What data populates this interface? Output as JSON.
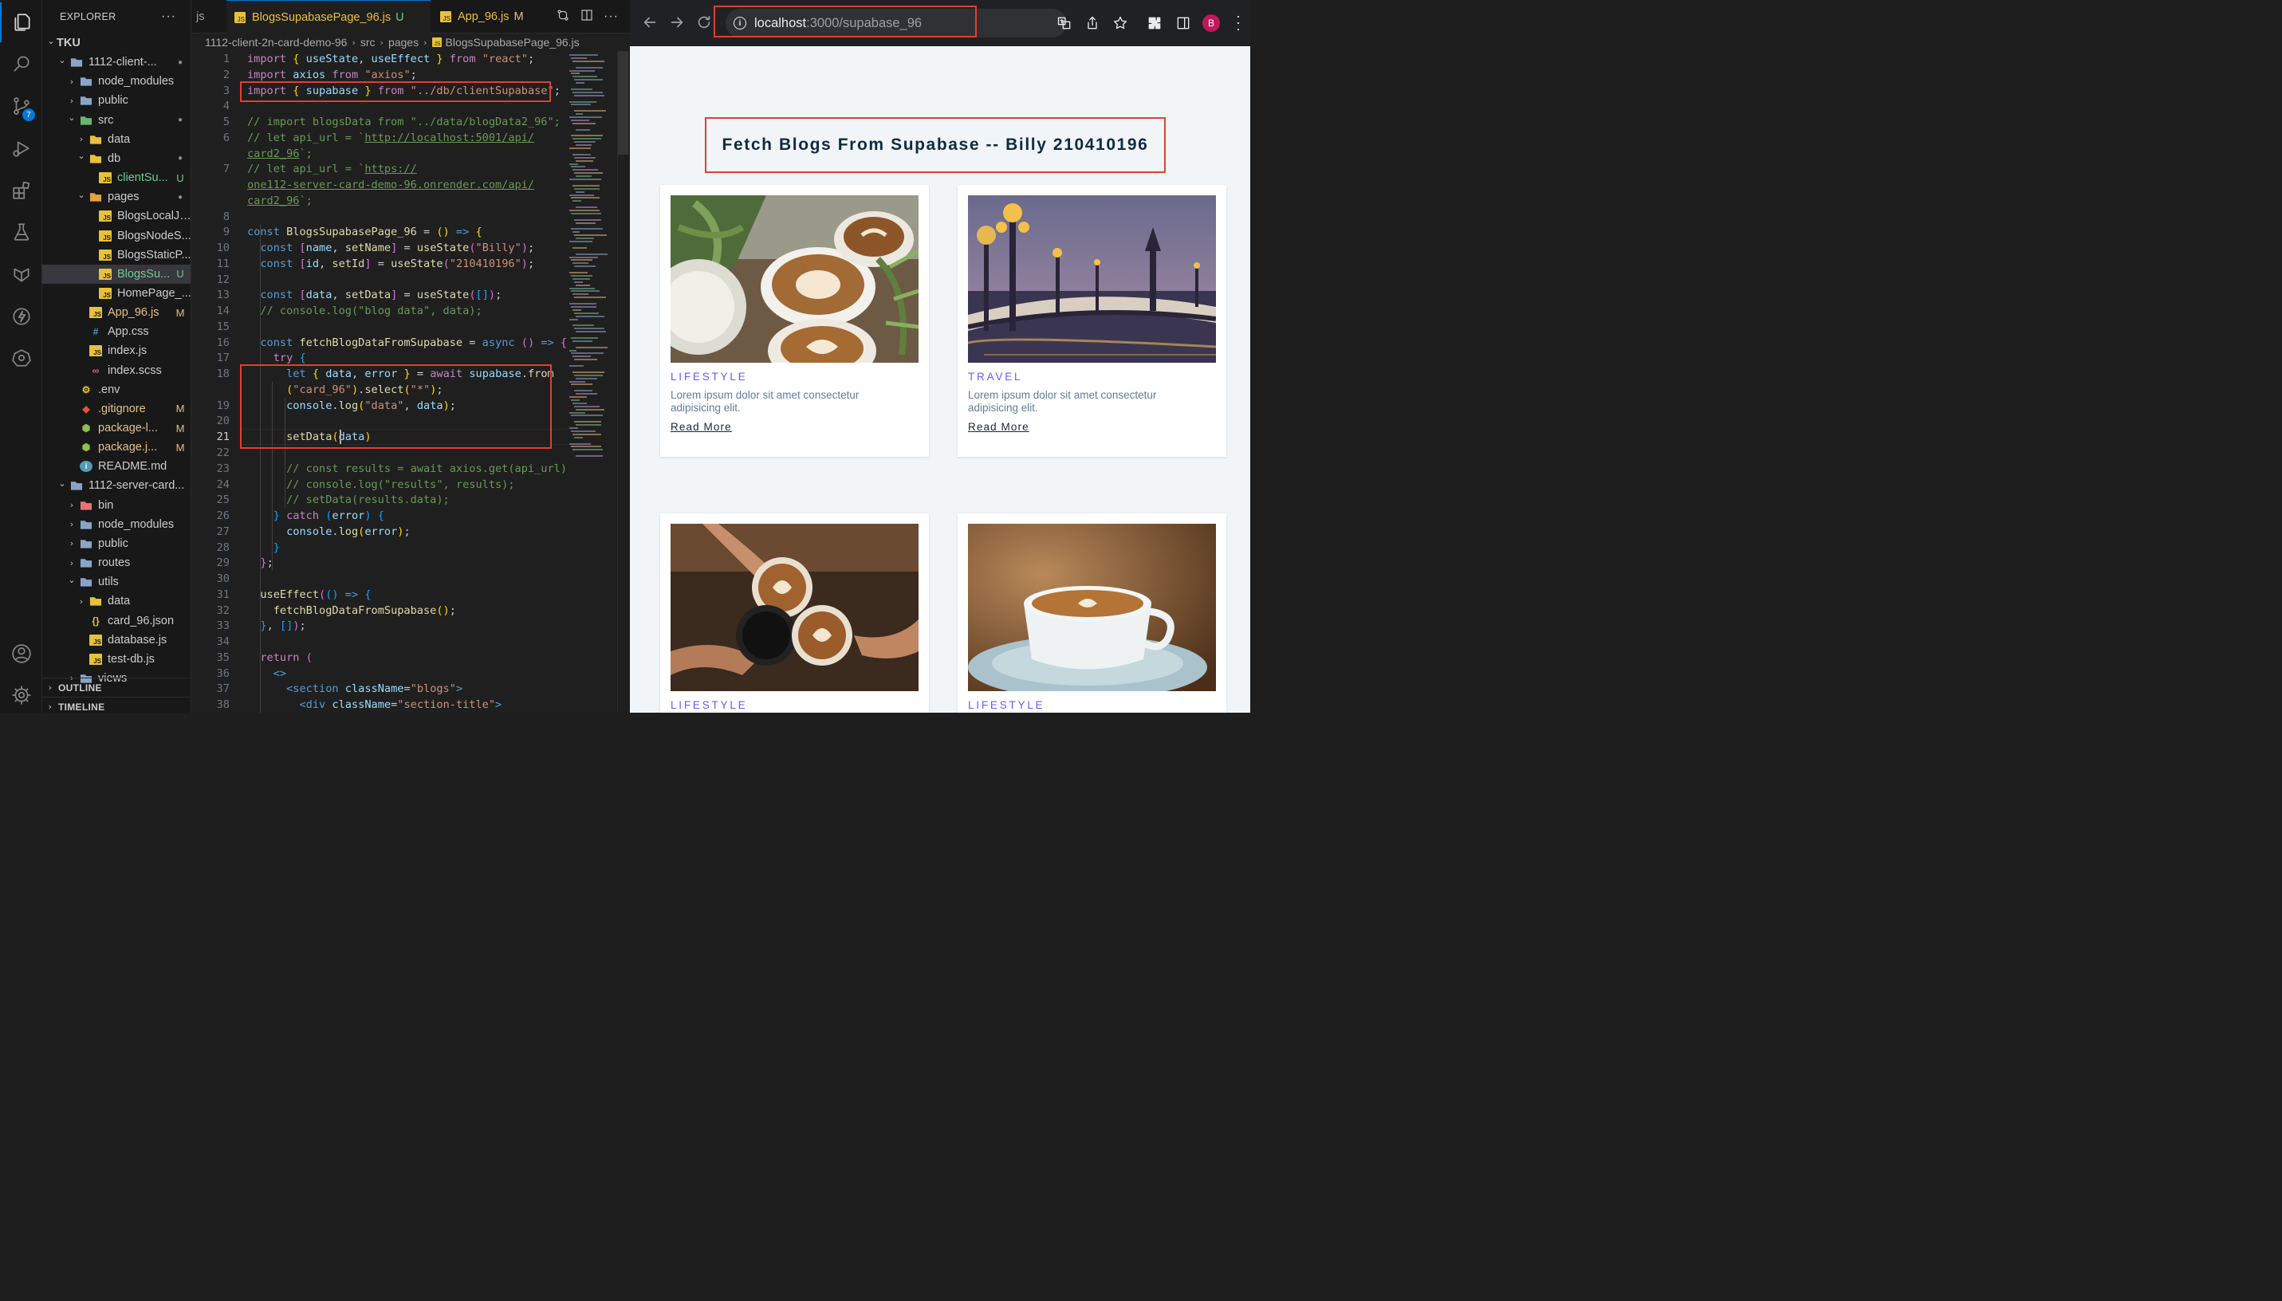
{
  "vscode": {
    "activity": {
      "scm_badge": "7"
    },
    "explorer": {
      "title": "EXPLORER",
      "more": "···",
      "tree": [
        {
          "label": "TKU",
          "level": 0,
          "type": "root",
          "open": true,
          "status": ""
        },
        {
          "label": "1112-client-...",
          "level": 1,
          "type": "folder",
          "open": true,
          "status": "dot"
        },
        {
          "label": "node_modules",
          "level": 2,
          "type": "folder-closed",
          "open": false,
          "status": ""
        },
        {
          "label": "public",
          "level": 2,
          "type": "folder-closed",
          "open": false,
          "status": ""
        },
        {
          "label": "src",
          "level": 2,
          "type": "folder-src",
          "open": true,
          "status": "dot"
        },
        {
          "label": "data",
          "level": 3,
          "type": "folder-yellow",
          "open": false,
          "status": ""
        },
        {
          "label": "db",
          "level": 3,
          "type": "folder-yellow",
          "open": true,
          "status": "dot"
        },
        {
          "label": "clientSu...",
          "level": 4,
          "type": "js",
          "status": "U"
        },
        {
          "label": "pages",
          "level": 3,
          "type": "folder-orange",
          "open": true,
          "status": "dot"
        },
        {
          "label": "BlogsLocalJs...",
          "level": 4,
          "type": "js",
          "status": ""
        },
        {
          "label": "BlogsNodeS...",
          "level": 4,
          "type": "js",
          "status": ""
        },
        {
          "label": "BlogsStaticP...",
          "level": 4,
          "type": "js",
          "status": ""
        },
        {
          "label": "BlogsSu...",
          "level": 4,
          "type": "js",
          "status": "U",
          "selected": true
        },
        {
          "label": "HomePage_...",
          "level": 4,
          "type": "js",
          "status": ""
        },
        {
          "label": "App_96.js",
          "level": 3,
          "type": "js",
          "status": "M"
        },
        {
          "label": "App.css",
          "level": 3,
          "type": "css",
          "status": ""
        },
        {
          "label": "index.js",
          "level": 3,
          "type": "js",
          "status": ""
        },
        {
          "label": "index.scss",
          "level": 3,
          "type": "scss",
          "status": ""
        },
        {
          "label": ".env",
          "level": 2,
          "type": "env",
          "status": ""
        },
        {
          "label": ".gitignore",
          "level": 2,
          "type": "git",
          "status": "M"
        },
        {
          "label": "package-l...",
          "level": 2,
          "type": "node",
          "status": "M"
        },
        {
          "label": "package.j...",
          "level": 2,
          "type": "node",
          "status": "M"
        },
        {
          "label": "README.md",
          "level": 2,
          "type": "info",
          "status": ""
        },
        {
          "label": "1112-server-card...",
          "level": 1,
          "type": "folder",
          "open": true,
          "status": ""
        },
        {
          "label": "bin",
          "level": 2,
          "type": "folder-red",
          "open": false,
          "status": ""
        },
        {
          "label": "node_modules",
          "level": 2,
          "type": "folder-closed",
          "open": false,
          "status": ""
        },
        {
          "label": "public",
          "level": 2,
          "type": "folder-closed",
          "open": false,
          "status": ""
        },
        {
          "label": "routes",
          "level": 2,
          "type": "folder-closed",
          "open": false,
          "status": ""
        },
        {
          "label": "utils",
          "level": 2,
          "type": "folder-closed",
          "open": true,
          "status": ""
        },
        {
          "label": "data",
          "level": 3,
          "type": "folder-yellow",
          "open": false,
          "status": ""
        },
        {
          "label": "card_96.json",
          "level": 3,
          "type": "json",
          "status": ""
        },
        {
          "label": "database.js",
          "level": 3,
          "type": "js",
          "status": ""
        },
        {
          "label": "test-db.js",
          "level": 3,
          "type": "js",
          "status": ""
        },
        {
          "label": "views",
          "level": 2,
          "type": "folder-closed",
          "open": false,
          "status": ""
        }
      ],
      "outline": "OUTLINE",
      "timeline": "TIMELINE"
    },
    "tabs": [
      {
        "label": "js",
        "status": ""
      },
      {
        "label": "BlogsSupabasePage_96.js",
        "status": "U",
        "active": true
      },
      {
        "label": "App_96.js",
        "status": "M"
      }
    ],
    "breadcrumb": [
      "1112-client-2n-card-demo-96",
      "src",
      "pages",
      "BlogsSupabasePage_96.js"
    ],
    "current_line": "21",
    "code": [
      {
        "n": "1",
        "html": "<span class='kw'>import</span> <span class='br1'>{</span> <span class='vr'>useState</span>, <span class='vr'>useEffect</span> <span class='br1'>}</span> <span class='kw'>from</span> <span class='str'>\"react\"</span>;"
      },
      {
        "n": "2",
        "html": "<span class='kw'>import</span> <span class='vr'>axios</span> <span class='kw'>from</span> <span class='str'>\"axios\"</span>;"
      },
      {
        "n": "3",
        "html": "<span class='kw'>import</span> <span class='br1'>{</span> <span class='vr'>supabase</span> <span class='br1'>}</span> <span class='kw'>from</span> <span class='str'>\"../db/clientSupabase\"</span>;"
      },
      {
        "n": "4",
        "html": ""
      },
      {
        "n": "5",
        "html": "<span class='cm'>// import blogsData from \"../data/blogData2_96\";</span>"
      },
      {
        "n": "6",
        "html": "<span class='cm'>// let api_url = `</span><span class='cmu'>http://localhost:5001/api/</span>"
      },
      {
        "n": "",
        "html": "<span class='cmu'>card2_96</span><span class='cm'>`;</span>"
      },
      {
        "n": "7",
        "html": "<span class='cm'>// let api_url = `</span><span class='cmu'>https://</span>"
      },
      {
        "n": "",
        "html": "<span class='cmu'>one112-server-card-demo-96.onrender.com/api/</span>"
      },
      {
        "n": "",
        "html": "<span class='cmu'>card2_96</span><span class='cm'>`;</span>"
      },
      {
        "n": "8",
        "html": ""
      },
      {
        "n": "9",
        "html": "<span class='kw2'>const</span> <span class='fn'>BlogsSupabasePage_96</span> = <span class='br1'>()</span> <span class='kw2'>=&gt;</span> <span class='br1'>{</span>"
      },
      {
        "n": "10",
        "html": "  <span class='kw2'>const</span> <span class='br2'>[</span><span class='vr'>name</span>, <span class='fn'>setName</span><span class='br2'>]</span> = <span class='fn'>useState</span><span class='br2'>(</span><span class='str'>\"Billy\"</span><span class='br2'>)</span>;"
      },
      {
        "n": "11",
        "html": "  <span class='kw2'>const</span> <span class='br2'>[</span><span class='vr'>id</span>, <span class='fn'>setId</span><span class='br2'>]</span> = <span class='fn'>useState</span><span class='br2'>(</span><span class='str'>\"210410196\"</span><span class='br2'>)</span>;"
      },
      {
        "n": "12",
        "html": ""
      },
      {
        "n": "13",
        "html": "  <span class='kw2'>const</span> <span class='br2'>[</span><span class='vr'>data</span>, <span class='fn'>setData</span><span class='br2'>]</span> = <span class='fn'>useState</span><span class='br2'>(</span><span class='br3'>[]</span><span class='br2'>)</span>;"
      },
      {
        "n": "14",
        "html": "  <span class='cm'>// console.log(\"blog data\", data);</span>"
      },
      {
        "n": "15",
        "html": ""
      },
      {
        "n": "16",
        "html": "  <span class='kw2'>const</span> <span class='fn'>fetchBlogDataFromSupabase</span> = <span class='kw2'>async</span> <span class='br2'>()</span> <span class='kw2'>=&gt;</span> <span class='br2'>{</span>"
      },
      {
        "n": "17",
        "html": "    <span class='kw'>try</span> <span class='br3'>{</span>"
      },
      {
        "n": "18",
        "html": "      <span class='kw2'>let</span> <span class='br1'>{</span> <span class='vr'>data</span>, <span class='vr'>error</span> <span class='br1'>}</span> = <span class='kw'>await</span> <span class='vr'>supabase</span>.<span class='fn'>from</span>"
      },
      {
        "n": "",
        "html": "      <span class='br1'>(</span><span class='str'>\"card_96\"</span><span class='br1'>)</span>.<span class='fn'>select</span><span class='br1'>(</span><span class='str'>\"*\"</span><span class='br1'>)</span>;"
      },
      {
        "n": "19",
        "html": "      <span class='vr'>console</span>.<span class='fn'>log</span><span class='br1'>(</span><span class='str'>\"data\"</span>, <span class='vr'>data</span><span class='br1'>)</span>;"
      },
      {
        "n": "20",
        "html": ""
      },
      {
        "n": "21",
        "html": "      <span class='fn'>setData</span><span class='br1'>(</span><span class='vr'>data</span><span class='br1'>)</span>"
      },
      {
        "n": "22",
        "html": ""
      },
      {
        "n": "23",
        "html": "      <span class='cm'>// const results = await axios.get(api_url);</span>"
      },
      {
        "n": "24",
        "html": "      <span class='cm'>// console.log(\"results\", results);</span>"
      },
      {
        "n": "25",
        "html": "      <span class='cm'>// setData(results.data);</span>"
      },
      {
        "n": "26",
        "html": "    <span class='br3'>}</span> <span class='kw'>catch</span> <span class='br3'>(</span><span class='vr'>error</span><span class='br3'>)</span> <span class='br3'>{</span>"
      },
      {
        "n": "27",
        "html": "      <span class='vr'>console</span>.<span class='fn'>log</span><span class='br1'>(</span><span class='vr'>error</span><span class='br1'>)</span>;"
      },
      {
        "n": "28",
        "html": "    <span class='br3'>}</span>"
      },
      {
        "n": "29",
        "html": "  <span class='br2'>}</span>;"
      },
      {
        "n": "30",
        "html": ""
      },
      {
        "n": "31",
        "html": "  <span class='fn'>useEffect</span><span class='br2'>(</span><span class='br3'>()</span> <span class='kw2'>=&gt;</span> <span class='br3'>{</span>"
      },
      {
        "n": "32",
        "html": "    <span class='fn'>fetchBlogDataFromSupabase</span><span class='br1'>()</span>;"
      },
      {
        "n": "33",
        "html": "  <span class='br3'>}</span>, <span class='br3'>[]</span><span class='br2'>)</span>;"
      },
      {
        "n": "34",
        "html": ""
      },
      {
        "n": "35",
        "html": "  <span class='kw'>return</span> <span class='br2'>(</span>"
      },
      {
        "n": "36",
        "html": "    <span class='tg'>&lt;&gt;</span>"
      },
      {
        "n": "37",
        "html": "      <span class='tg'>&lt;section</span> <span class='at'>className</span>=<span class='str'>\"blogs\"</span><span class='tg'>&gt;</span>"
      },
      {
        "n": "38",
        "html": "        <span class='tg'>&lt;div</span> <span class='at'>className</span>=<span class='str'>\"section-title\"</span><span class='tg'>&gt;</span>"
      }
    ]
  },
  "browser": {
    "url_host": "localhost",
    "url_path": ":3000/supabase_96",
    "avatar": "B",
    "page": {
      "title": "Fetch Blogs From Supabase -- Billy 210410196",
      "cards": [
        {
          "category": "LIFESTYLE",
          "description": "Lorem ipsum dolor sit amet consectetur adipisicing elit.",
          "link": "Read More",
          "image": "coffee-plants"
        },
        {
          "category": "TRAVEL",
          "description": "Lorem ipsum dolor sit amet consectetur adipisicing elit.",
          "link": "Read More",
          "image": "bridge-night"
        },
        {
          "category": "LIFESTYLE",
          "description": "",
          "link": "",
          "image": "coffee-cheers"
        },
        {
          "category": "LIFESTYLE",
          "description": "",
          "link": "",
          "image": "coffee-cup"
        }
      ]
    }
  },
  "colors": {
    "annotation_red": "#e0402e",
    "category_purple": "#645cff",
    "vscode_bg": "#1f1f1f"
  }
}
